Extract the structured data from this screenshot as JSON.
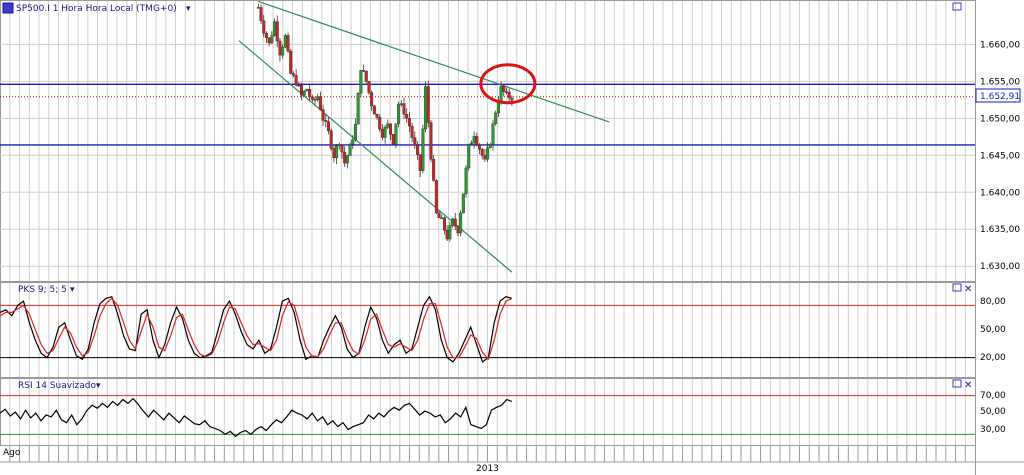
{
  "main": {
    "title": "SP500.I 1 Hora Hora Local (TMG+0)",
    "icon": "instrument-icon",
    "last_price_label": "1.652,91",
    "colors": {
      "bull": "#2a9a2a",
      "bear": "#cc2222",
      "trend": "#2e8b57",
      "support": "#1a1acc",
      "price_line": "#cc0000",
      "highlight": "#dd1111"
    }
  },
  "pks": {
    "title": "PKS 9; 5; 5",
    "level_high_label": "80,00",
    "level_mid_label": "50,00",
    "level_low_label": "20,00"
  },
  "rsi": {
    "title": "RSI 14 Suavizado",
    "level_high_label": "70,00",
    "level_mid_label": "50,00",
    "level_low_label": "30,00"
  },
  "time_axis": {
    "left_label": "Ago",
    "year_label": "2013"
  },
  "chart_data": [
    {
      "type": "candlestick",
      "title": "SP500.I 1 Hora Hora Local (TMG+0)",
      "ylim": [
        1628,
        1666
      ],
      "yticks": [
        "1.630,00",
        "1.635,00",
        "1.640,00",
        "1.645,00",
        "1.650,00",
        "1.655,00",
        "1.660,00"
      ],
      "y_values_ticks": [
        1630,
        1635,
        1640,
        1645,
        1650,
        1655,
        1660
      ],
      "x_count": 54,
      "x_start_index": 26,
      "close_path": [
        1665,
        1662,
        1660,
        1663,
        1659,
        1661,
        1656,
        1655,
        1653,
        1654,
        1652,
        1653,
        1650,
        1648,
        1645,
        1647,
        1644,
        1646,
        1649,
        1657,
        1655,
        1652,
        1650,
        1648,
        1649,
        1647,
        1652,
        1651,
        1649,
        1646,
        1643,
        1654,
        1645,
        1637,
        1636,
        1634,
        1636,
        1635,
        1640,
        1646,
        1648,
        1646,
        1644,
        1647,
        1651,
        1654,
        1653,
        1652.9
      ],
      "horizontal_lines": [
        {
          "value": 1654.6,
          "color": "blue"
        },
        {
          "value": 1652.91,
          "color": "red-dotted"
        },
        {
          "value": 1646.4,
          "color": "blue"
        }
      ],
      "trendlines": [
        {
          "from": {
            "i": 26,
            "v": 1665.8
          },
          "to": {
            "i": 62,
            "v": 1649.5
          }
        },
        {
          "from": {
            "i": 24,
            "v": 1660.5
          },
          "to": {
            "i": 52,
            "v": 1629.2
          }
        }
      ],
      "annotation": {
        "type": "ellipse",
        "at": {
          "i": 52,
          "v": 1654
        }
      }
    },
    {
      "type": "line",
      "title": "PKS 9; 5; 5",
      "ylim": [
        0,
        100
      ],
      "levels": [
        80,
        20
      ],
      "series": [
        {
          "color": "black",
          "values": [
            72,
            75,
            68,
            80,
            85,
            60,
            40,
            25,
            20,
            32,
            55,
            60,
            40,
            22,
            18,
            30,
            60,
            82,
            88,
            90,
            70,
            45,
            30,
            28,
            70,
            75,
            40,
            20,
            35,
            60,
            78,
            65,
            40,
            25,
            20,
            22,
            26,
            50,
            75,
            85,
            70,
            50,
            35,
            30,
            40,
            25,
            30,
            55,
            85,
            88,
            72,
            40,
            18,
            22,
            20,
            40,
            55,
            68,
            55,
            30,
            20,
            25,
            55,
            78,
            65,
            40,
            25,
            35,
            40,
            25,
            30,
            55,
            80,
            90,
            75,
            40,
            20,
            15,
            25,
            40,
            55,
            35,
            15,
            20,
            60,
            85,
            90,
            88
          ]
        },
        {
          "color": "red",
          "values": [
            68,
            72,
            72,
            76,
            80,
            70,
            52,
            35,
            25,
            28,
            42,
            55,
            48,
            32,
            22,
            26,
            45,
            68,
            82,
            88,
            80,
            60,
            40,
            30,
            50,
            70,
            55,
            32,
            28,
            45,
            66,
            70,
            52,
            35,
            24,
            21,
            24,
            38,
            60,
            78,
            76,
            60,
            45,
            35,
            36,
            32,
            28,
            40,
            68,
            84,
            80,
            56,
            32,
            22,
            21,
            30,
            46,
            60,
            60,
            42,
            28,
            24,
            40,
            64,
            70,
            52,
            35,
            32,
            36,
            32,
            28,
            40,
            64,
            82,
            82,
            58,
            32,
            20,
            20,
            32,
            46,
            42,
            26,
            18,
            40,
            70,
            85,
            88
          ]
        }
      ]
    },
    {
      "type": "line",
      "title": "RSI 14 Suavizado",
      "ylim": [
        20,
        80
      ],
      "levels": [
        70,
        30
      ],
      "series": [
        {
          "color": "black",
          "values": [
            52,
            56,
            49,
            53,
            46,
            55,
            47,
            52,
            44,
            50,
            48,
            55,
            45,
            42,
            50,
            40,
            46,
            55,
            60,
            57,
            62,
            58,
            64,
            60,
            66,
            62,
            67,
            61,
            54,
            48,
            55,
            50,
            45,
            52,
            47,
            42,
            49,
            45,
            41,
            40,
            44,
            38,
            36,
            34,
            30,
            33,
            28,
            32,
            34,
            30,
            35,
            38,
            34,
            40,
            45,
            42,
            48,
            55,
            52,
            50,
            46,
            52,
            44,
            48,
            40,
            44,
            38,
            42,
            35,
            38,
            40,
            42,
            50,
            46,
            52,
            48,
            54,
            58,
            55,
            60,
            62,
            56,
            50,
            54,
            52,
            48,
            50,
            42,
            46,
            52,
            48,
            58,
            40,
            38,
            36,
            40,
            55,
            58,
            60,
            66,
            64
          ]
        }
      ]
    }
  ]
}
